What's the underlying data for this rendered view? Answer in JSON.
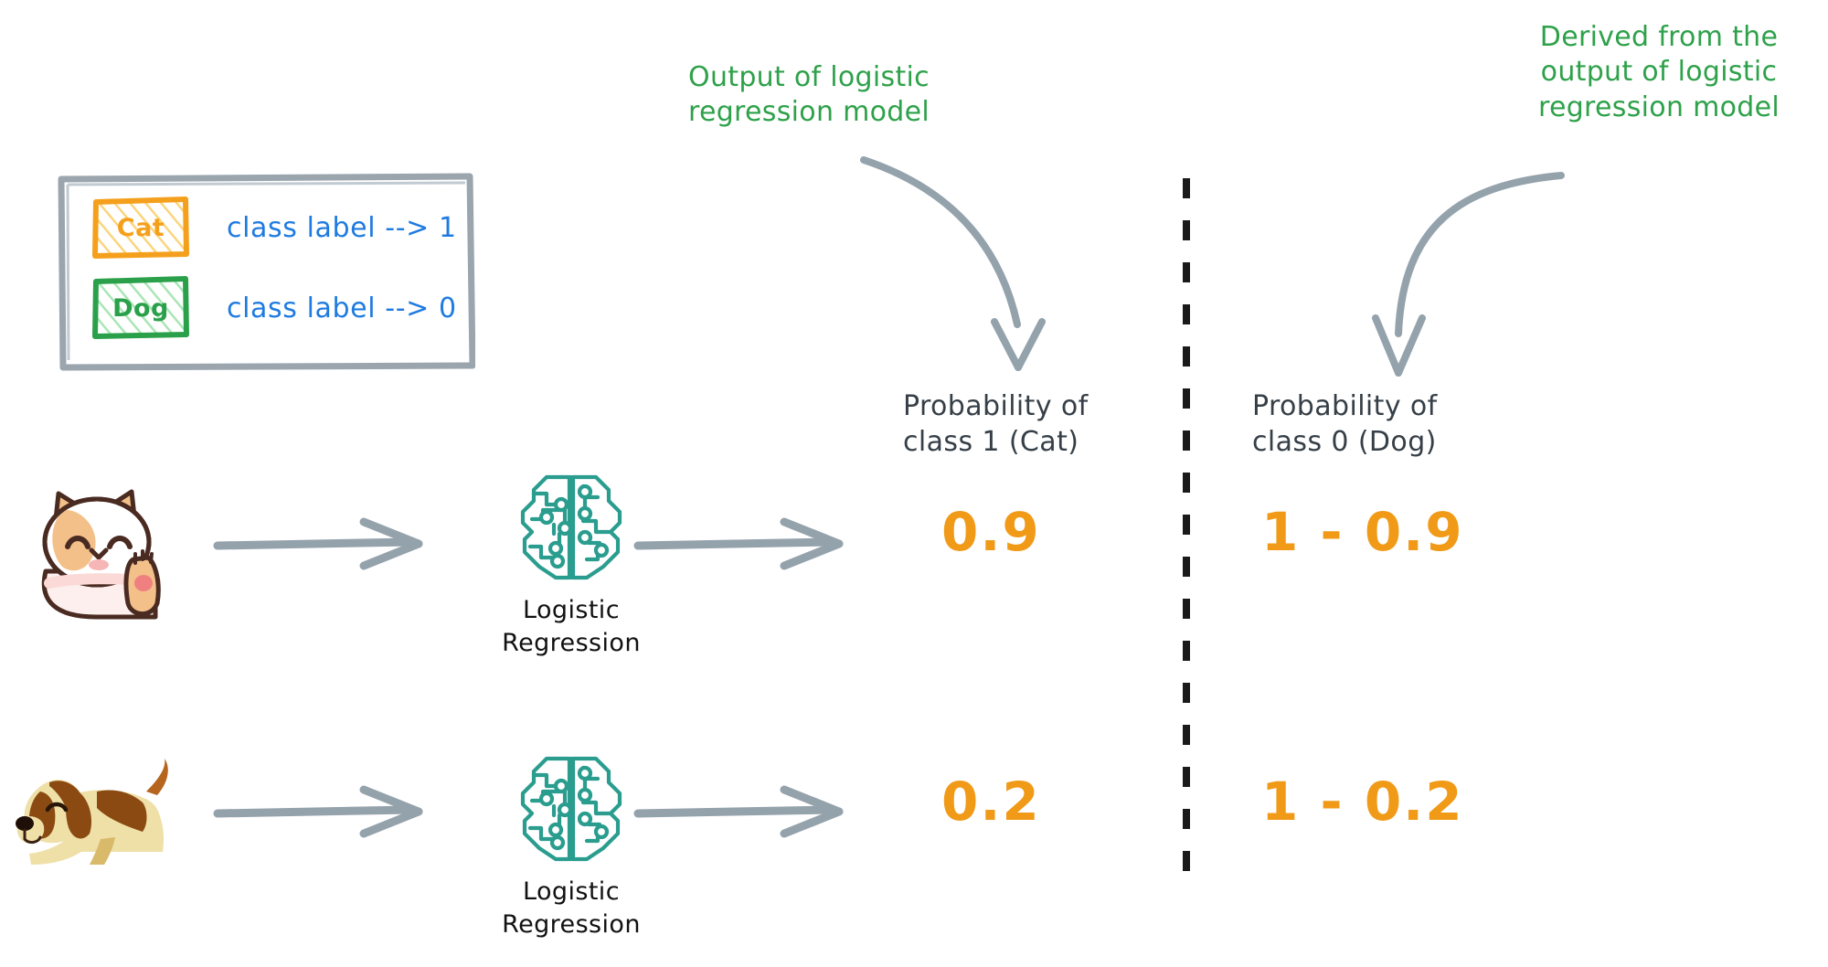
{
  "diagram": {
    "title": "Logistic regression class probability diagram",
    "colors": {
      "orange": "#F09A18",
      "green": "#2EA14A",
      "blue": "#1F7BE0",
      "teal": "#2A9D8F",
      "gray_arrow": "#94A2AC",
      "dark_text": "#363F47"
    }
  },
  "legend": {
    "items": [
      {
        "swatch_text": "Cat",
        "label": "class label --> 1",
        "swatch_color": "#F5A01C"
      },
      {
        "swatch_text": "Dog",
        "label": "class label --> 0",
        "swatch_color": "#2AA04A"
      }
    ]
  },
  "annotations": {
    "left": "Output of logistic\nregression model",
    "right": "Derived from the\noutput of logistic\nregression model"
  },
  "columns": {
    "class1_header": "Probability of\nclass 1 (Cat)",
    "class0_header": "Probability of\nclass 0 (Dog)"
  },
  "rows": [
    {
      "animal": "cat",
      "animal_icon": "cat-illustration",
      "model_icon": "brain-circuit-icon",
      "model_label": "Logistic\nRegression",
      "prob_class1": "0.9",
      "prob_class0": "1 - 0.9"
    },
    {
      "animal": "dog",
      "animal_icon": "dog-illustration",
      "model_icon": "brain-circuit-icon",
      "model_label": "Logistic\nRegression",
      "prob_class1": "0.2",
      "prob_class0": "1 - 0.2"
    }
  ]
}
